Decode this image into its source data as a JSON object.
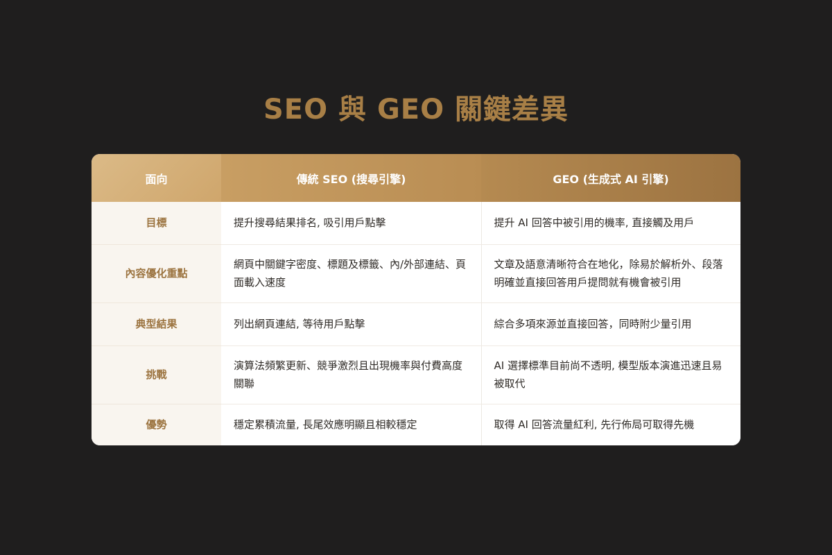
{
  "title": "SEO 與 GEO 關鍵差異",
  "table": {
    "headers": {
      "aspect": "面向",
      "seo": "傳統 SEO (搜尋引擎)",
      "geo": "GEO (生成式 AI 引擎)"
    },
    "rows": [
      {
        "aspect": "目標",
        "seo": "提升搜尋結果排名, 吸引用戶點擊",
        "geo": "提升 AI 回答中被引用的機率, 直接觸及用戶"
      },
      {
        "aspect": "內容優化重點",
        "seo": "網頁中關鍵字密度、標題及標籤、內/外部連結、頁面載入速度",
        "geo": "文章及語意清晰符合在地化，除易於解析外、段落明確並直接回答用戶提問就有機會被引用"
      },
      {
        "aspect": "典型結果",
        "seo": "列出網頁連結, 等待用戶點擊",
        "geo": "綜合多項來源並直接回答，同時附少量引用"
      },
      {
        "aspect": "挑戰",
        "seo": "演算法頻繁更新、競爭激烈且出現機率與付費高度關聯",
        "geo": "AI 選擇標準目前尚不透明, 模型版本演進迅速且易被取代"
      },
      {
        "aspect": "優勢",
        "seo": "穩定累積流量, 長尾效應明顯且相較穩定",
        "geo": "取得 AI 回答流量紅利, 先行佈局可取得先機"
      }
    ]
  }
}
